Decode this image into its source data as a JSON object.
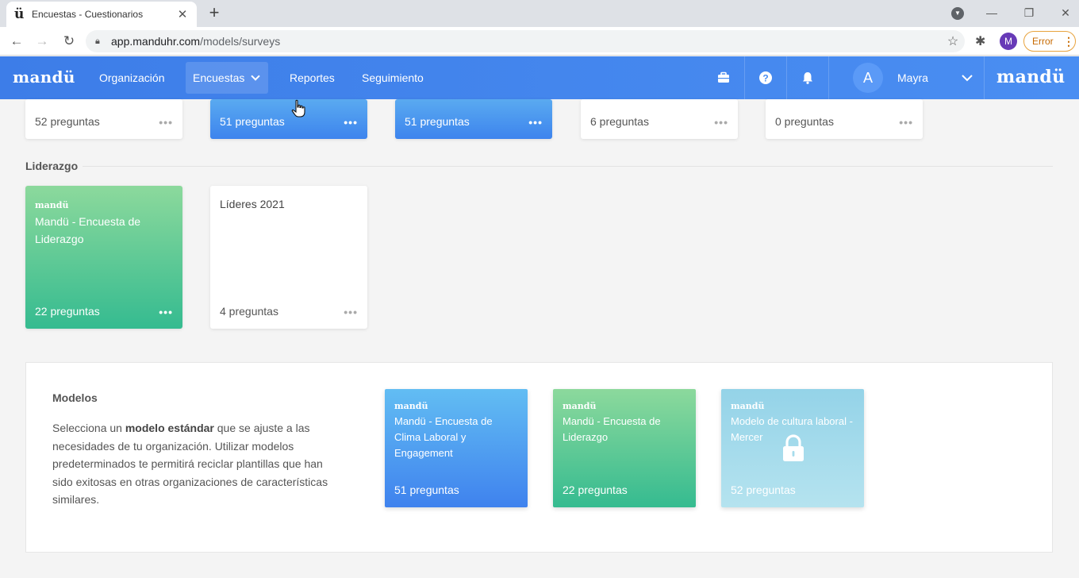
{
  "browser": {
    "tab_title": "Encuestas - Cuestionarios",
    "tab_favicon": "ü",
    "url_host": "app.manduhr.com",
    "url_path": "/models/surveys",
    "profile_letter": "M",
    "error_label": "Error"
  },
  "header": {
    "logo": "mandü",
    "logo_right": "mandü",
    "menu": [
      "Organización",
      "Encuestas",
      "Reportes",
      "Seguimiento"
    ],
    "user_initial": "A",
    "user_name": "Mayra",
    "colors": {
      "bar": "#3d7de8"
    }
  },
  "top_cards": [
    {
      "count": "52 preguntas",
      "style": "white"
    },
    {
      "count": "51 preguntas",
      "style": "blue"
    },
    {
      "count": "51 preguntas",
      "style": "blue"
    },
    {
      "count": "6 preguntas",
      "style": "white"
    },
    {
      "count": "0 preguntas",
      "style": "white"
    }
  ],
  "liderazgo": {
    "label": "Liderazgo",
    "cards": [
      {
        "brand": "mandü",
        "title": "Mandü - Encuesta de Liderazgo",
        "count": "22 preguntas",
        "style": "green"
      },
      {
        "title": "Líderes 2021",
        "count": "4 preguntas",
        "style": "white"
      }
    ]
  },
  "modelos": {
    "title": "Modelos",
    "desc_pre": "Selecciona un ",
    "desc_bold": "modelo estándar",
    "desc_post": " que se ajuste a las necesidades de tu organización. Utilizar modelos predeterminados te permitirá reciclar plantillas que han sido exitosas en otras organizaciones de características similares.",
    "cards": [
      {
        "brand": "mandü",
        "title": "Mandü - Encuesta de Clima Laboral y Engagement",
        "count": "51 preguntas",
        "style": "blue"
      },
      {
        "brand": "mandü",
        "title": "Mandü - Encuesta de Liderazgo",
        "count": "22 preguntas",
        "style": "green"
      },
      {
        "brand": "mandü",
        "title": "Modelo de cultura laboral - Mercer",
        "count": "52 preguntas",
        "style": "lightblue",
        "locked": true
      }
    ]
  },
  "dots": "•••"
}
